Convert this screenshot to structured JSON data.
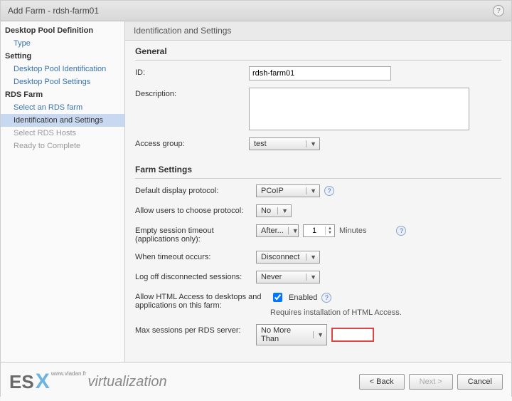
{
  "title": "Add Farm - rdsh-farm01",
  "sidebar": {
    "group1": "Desktop Pool Definition",
    "item_type": "Type",
    "group2": "Setting",
    "item_dpi": "Desktop Pool Identification",
    "item_dps": "Desktop Pool Settings",
    "group3": "RDS Farm",
    "item_select_rds": "Select an RDS farm",
    "item_ident": "Identification and Settings",
    "item_hosts": "Select RDS Hosts",
    "item_ready": "Ready to Complete"
  },
  "content": {
    "heading": "Identification and Settings",
    "general": {
      "title": "General",
      "id_label": "ID:",
      "id_value": "rdsh-farm01",
      "desc_label": "Description:",
      "desc_value": "",
      "access_label": "Access group:",
      "access_value": "test"
    },
    "farm": {
      "title": "Farm Settings",
      "protocol_label": "Default display protocol:",
      "protocol_value": "PCoIP",
      "allow_choose_label": "Allow users to choose protocol:",
      "allow_choose_value": "No",
      "empty_label": "Empty session timeout (applications only):",
      "empty_value": "After...",
      "empty_num": "1",
      "empty_unit": "Minutes",
      "timeout_label": "When timeout occurs:",
      "timeout_value": "Disconnect",
      "logoff_label": "Log off disconnected sessions:",
      "logoff_value": "Never",
      "html_label": "Allow HTML Access to desktops and applications on this farm:",
      "html_enabled": "Enabled",
      "html_note": "Requires installation of HTML Access.",
      "max_label": "Max sessions per RDS server:",
      "max_value": "No More Than",
      "max_input": ""
    }
  },
  "footer": {
    "logo_es": "ES",
    "logo_x": "X",
    "logo_rest": "virtualization",
    "logo_sub": "www.vladan.fr",
    "back": "< Back",
    "next": "Next >",
    "cancel": "Cancel"
  }
}
